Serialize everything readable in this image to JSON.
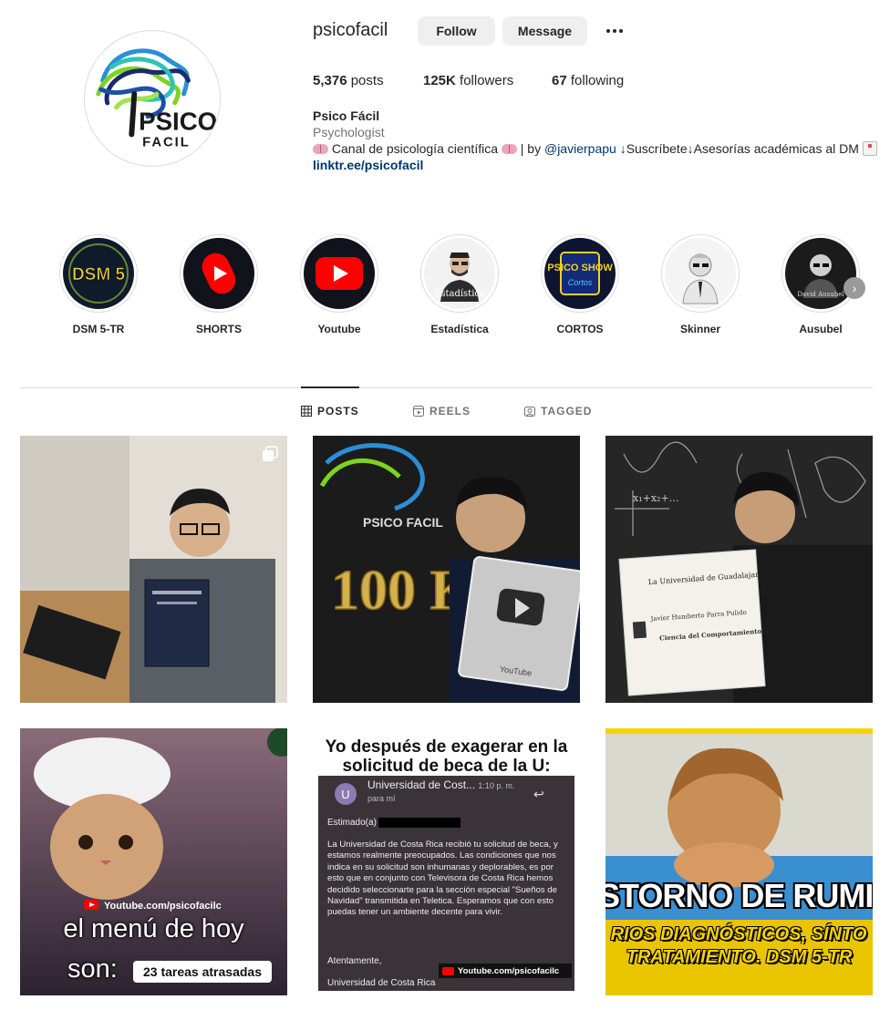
{
  "profile": {
    "username": "psicofacil",
    "follow_label": "Follow",
    "message_label": "Message",
    "avatar_text_top": "PSICO",
    "avatar_text_bottom": "FACIL"
  },
  "stats": {
    "posts_count": "5,376",
    "posts_label": "posts",
    "followers_count": "125K",
    "followers_label": "followers",
    "following_count": "67",
    "following_label": "following"
  },
  "bio": {
    "name": "Psico Fácil",
    "category": "Psychologist",
    "line1_a": "Canal de psicología científica",
    "line1_b": "| by",
    "mention": "@javierpapu",
    "line1_c": "↓Suscríbete↓Asesorías académicas al DM",
    "link": "linktr.ee/psicofacil"
  },
  "highlights": [
    {
      "label": "DSM 5-TR",
      "art": "DSM 5"
    },
    {
      "label": "SHORTS"
    },
    {
      "label": "Youtube"
    },
    {
      "label": "Estadística",
      "art": "Estadística"
    },
    {
      "label": "CORTOS",
      "art": "PSICO SHOW"
    },
    {
      "label": "Skinner"
    },
    {
      "label": "Ausubel",
      "art": "David Ausubel"
    }
  ],
  "tabs": {
    "posts": "POSTS",
    "reels": "REELS",
    "tagged": "TAGGED"
  },
  "posts": {
    "p2_text": "100 K",
    "p2_logo": "PSICO FACIL",
    "p2_plaque": "YouTube",
    "p3_diploma_title": "La Universidad de Guadalajara",
    "p3_diploma_name": "Javier Humberto Parra Pulido",
    "p3_diploma_degree": "Ciencia del Comportamiento",
    "p4_youtube": "Youtube.com/psicofacilc",
    "p4_line1": "el menú de hoy",
    "p4_line2": "son:",
    "p4_badge": "23 tareas atrasadas",
    "p5_title": "Yo después de exagerar en la solicitud de beca de la U:",
    "p5_sender": "Universidad de Cost...",
    "p5_time": "1:10 p. m.",
    "p5_to": "para mí",
    "p5_greeting": "Estimado(a)",
    "p5_body": "La Universidad de Costa Rica recibió tu solicitud de beca, y estamos realmente preocupados. Las condiciones que nos indica en su solicitud son inhumanas y deplorables, es por esto que en conjunto con Televisora de Costa Rica hemos decidido seleccionarte para la sección especial \"Sueños de Navidad\" transmitida en Teletica. Esperamos que con esto puedas tener un ambiente decente para vivir.",
    "p5_closing": "Atentamente,",
    "p5_signature": "Universidad de Costa Rica",
    "p5_youtube": "Youtube.com/psicofacilc",
    "p6_line1": "STORNO DE RUMIA",
    "p6_line2": "RIOS DIAGNÓSTICOS, SÍNTO",
    "p6_line3": "TRATAMIENTO. DSM 5-TR"
  }
}
